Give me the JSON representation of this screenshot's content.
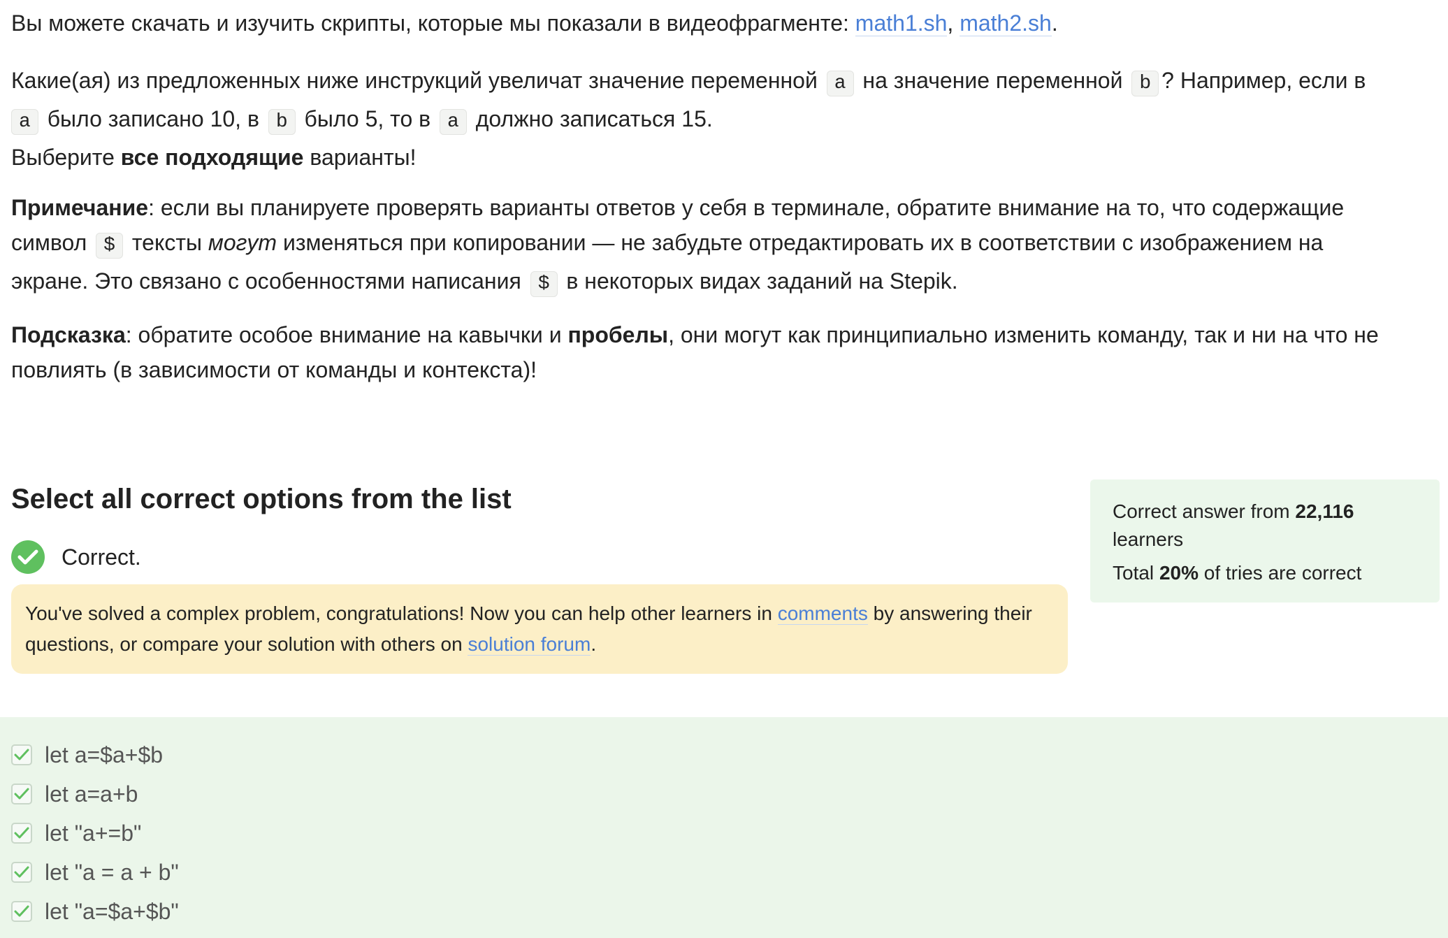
{
  "intro": {
    "text": "Вы можете скачать и изучить скрипты, которые мы показали в видеофрагменте: ",
    "link1": "math1.sh",
    "sep": ", ",
    "link2": "math2.sh",
    "end": "."
  },
  "task": {
    "t1": "Какие(ая) из предложенных ниже инструкций увеличат значение переменной ",
    "var_a": "a",
    "t2": " на значение переменной ",
    "var_b": "b",
    "t3": "? Например, если в ",
    "t4": " было записано 10, в ",
    "t5": " было 5, то в ",
    "t6": " должно записаться 15.",
    "t7": "Выберите ",
    "t7_bold": "все подходящие",
    "t8": " варианты!"
  },
  "note": {
    "label": "Примечание",
    "t1": ": если вы планируете проверять варианты ответов у себя в терминале, обратите внимание на то, что содержащие символ ",
    "dollar": "$",
    "t2": " тексты ",
    "t2_italic": "могут",
    "t3": " изменяться при копировании — не забудьте отредактировать их в соответствии с изображением на экране. Это связано с особенностями написания ",
    "t4": " в некоторых видах заданий на Stepik."
  },
  "hint": {
    "label": "Подсказка",
    "t1": ": обратите особое внимание на кавычки и ",
    "bold": "пробелы",
    "t2": ", они могут как принципиально изменить команду, так и ни на что не повлиять (в зависимости от команды и контекста)!"
  },
  "question": {
    "title": "Select all correct options from the list",
    "status": "Correct.",
    "colors": {
      "success": "#5fc05f",
      "notice_bg": "#fcefc7",
      "answers_bg": "#ebf6ea",
      "link": "#4a7fd6"
    }
  },
  "notice": {
    "t1": "You've solved a complex problem, congratulations! Now you can help other learners in ",
    "link1": "comments",
    "t2": " by answering their questions, or compare your solution with others on ",
    "link2": "solution forum",
    "t3": "."
  },
  "stats": {
    "prefix": "Correct answer from ",
    "learners_count": "22,116",
    "learners_suffix": " learners",
    "total_prefix": "Total ",
    "percent": "20%",
    "total_suffix": " of tries are correct"
  },
  "options": [
    {
      "label": "let a=$a+$b",
      "checked": true
    },
    {
      "label": "let a=a+b",
      "checked": true
    },
    {
      "label": "let \"a+=b\"",
      "checked": true
    },
    {
      "label": "let \"a = a + b\"",
      "checked": true
    },
    {
      "label": "let \"a=$a+$b\"",
      "checked": true
    }
  ]
}
